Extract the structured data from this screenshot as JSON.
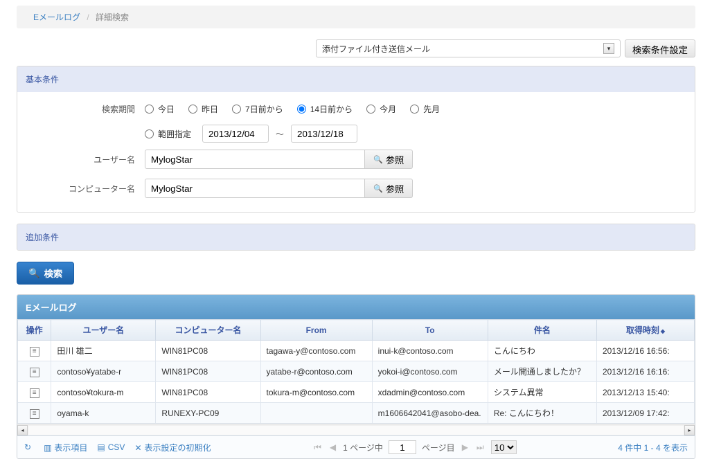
{
  "breadcrumb": {
    "link": "Eメールログ",
    "current": "詳細検索"
  },
  "toolbar": {
    "filter_selected": "添付ファイル付き送信メール",
    "settings_btn": "検索条件設定"
  },
  "panels": {
    "basic_title": "基本条件",
    "additional_title": "追加条件"
  },
  "labels": {
    "period": "検索期間",
    "user": "ユーザー名",
    "computer": "コンピューター名",
    "ref": "参照",
    "search": "検索"
  },
  "radios": {
    "today": "今日",
    "yesterday": "昨日",
    "from7": "7日前から",
    "from14": "14日前から",
    "thismonth": "今月",
    "lastmonth": "先月",
    "range": "範囲指定",
    "selected": "from14"
  },
  "dates": {
    "from": "2013/12/04",
    "to": "2013/12/18",
    "sep": "〜"
  },
  "inputs": {
    "user": "MylogStar",
    "computer": "MylogStar"
  },
  "grid": {
    "title": "Eメールログ",
    "headers": {
      "op": "操作",
      "user": "ユーザー名",
      "computer": "コンピューター名",
      "from": "From",
      "to": "To",
      "subject": "件名",
      "time": "取得時刻"
    },
    "sort_indicator": "◆",
    "rows": [
      {
        "user": "田川 雄二",
        "computer": "WIN81PC08",
        "from": "tagawa-y@contoso.com",
        "to": "inui-k@contoso.com",
        "subject": "こんにちわ",
        "time": "2013/12/16 16:56:"
      },
      {
        "user": "contoso¥yatabe-r",
        "computer": "WIN81PC08",
        "from": "yatabe-r@contoso.com",
        "to": "yokoi-i@contoso.com",
        "subject": "メール開通しましたか？",
        "time": "2013/12/16 16:16:"
      },
      {
        "user": "contoso¥tokura-m",
        "computer": "WIN81PC08",
        "from": "tokura-m@contoso.com",
        "to": "xdadmin@contoso.com",
        "subject": "システム異常",
        "time": "2013/12/13 15:40:"
      },
      {
        "user": "oyama-k",
        "computer": "RUNEXY-PC09",
        "from": "",
        "to": "m1606642041@asobo-dea.",
        "subject": "Re: こんにちわ！",
        "time": "2013/12/09 17:42:"
      }
    ]
  },
  "footer": {
    "refresh": "",
    "columns": "表示項目",
    "csv": "CSV",
    "reset": "表示設定の初期化",
    "page_before": "1 ページ中",
    "page_val": "1",
    "page_after": "ページ目",
    "pagesize": "10",
    "count": "4 件中 1 - 4 を表示"
  }
}
